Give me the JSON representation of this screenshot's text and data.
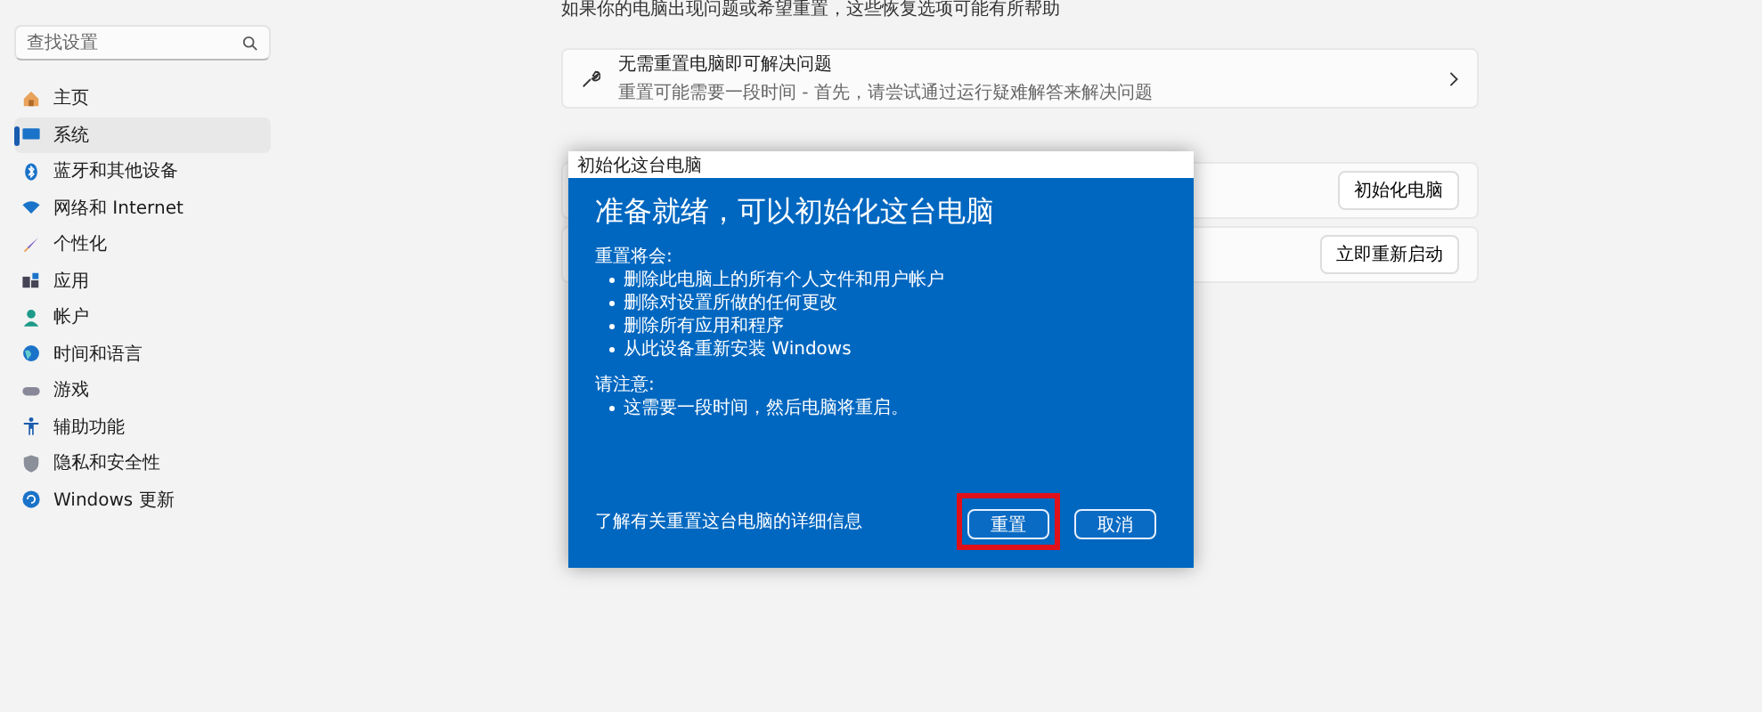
{
  "sidebar": {
    "search": {
      "placeholder": "查找设置"
    },
    "items": [
      {
        "label": "主页",
        "kind": "home",
        "selected": false
      },
      {
        "label": "系统",
        "kind": "system",
        "selected": true
      },
      {
        "label": "蓝牙和其他设备",
        "kind": "bluetooth",
        "selected": false
      },
      {
        "label": "网络和 Internet",
        "kind": "wifi",
        "selected": false
      },
      {
        "label": "个性化",
        "kind": "brush",
        "selected": false
      },
      {
        "label": "应用",
        "kind": "apps",
        "selected": false
      },
      {
        "label": "帐户",
        "kind": "person",
        "selected": false
      },
      {
        "label": "时间和语言",
        "kind": "globe",
        "selected": false
      },
      {
        "label": "游戏",
        "kind": "gamepad",
        "selected": false
      },
      {
        "label": "辅助功能",
        "kind": "accessibility",
        "selected": false
      },
      {
        "label": "隐私和安全性",
        "kind": "shield",
        "selected": false
      },
      {
        "label": "Windows 更新",
        "kind": "update",
        "selected": false
      }
    ]
  },
  "content": {
    "intro": "如果你的电脑出现问题或希望重置，这些恢复选项可能有所帮助",
    "fix_card": {
      "title": "无需重置电脑即可解决问题",
      "subtitle": "重置可能需要一段时间 - 首先，请尝试通过运行疑难解答来解决问题"
    },
    "option_buttons": [
      "初始化电脑",
      "立即重新启动"
    ]
  },
  "dialog": {
    "title": "初始化这台电脑",
    "heading": "准备就绪，可以初始化这台电脑",
    "section_1": "重置将会:",
    "bullets_1": [
      "删除此电脑上的所有个人文件和用户帐户",
      "删除对设置所做的任何更改",
      "删除所有应用和程序",
      "从此设备重新安装 Windows"
    ],
    "section_2": "请注意:",
    "bullets_2": [
      "这需要一段时间，然后电脑将重启。"
    ],
    "link": "了解有关重置这台电脑的详细信息",
    "buttons": [
      {
        "label": "重置",
        "highlighted": true
      },
      {
        "label": "取消",
        "highlighted": false
      }
    ]
  }
}
